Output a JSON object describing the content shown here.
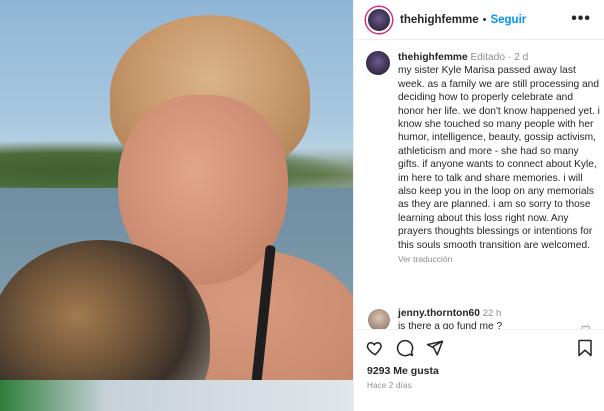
{
  "post": {
    "username": "thehighfemme",
    "follow_label": "Seguir",
    "separator": "•",
    "more_label": "•••"
  },
  "caption": {
    "username": "thehighfemme",
    "edited": "Editado",
    "age": "2 d",
    "text": "my sister Kyle Marisa passed away last week. as a family we are still processing and deciding how to properly celebrate and honor her life. we don't know happened yet. i know she touched so many people with her humor, intelligence, beauty, gossip activism, athleticism and more - she had so many gifts. if anyone wants to connect about Kyle, im here to talk and share memories. i will also keep you in the loop on any memorials as they are planned. i am so sorry to those learning about this loss right now. Any prayers thoughts blessings or intentions for this souls smooth transition are welcomed.",
    "translate_label": "Ver traducción"
  },
  "comments": [
    {
      "username": "jenny.thornton60",
      "age": "22 h",
      "text": "is there a go fund me ?"
    }
  ],
  "actions": {
    "likes": "9293 Me gusta",
    "posted": "Hace 2 días"
  },
  "icons": [
    "heart-icon",
    "comment-icon",
    "share-icon",
    "bookmark-icon",
    "more-icon"
  ]
}
